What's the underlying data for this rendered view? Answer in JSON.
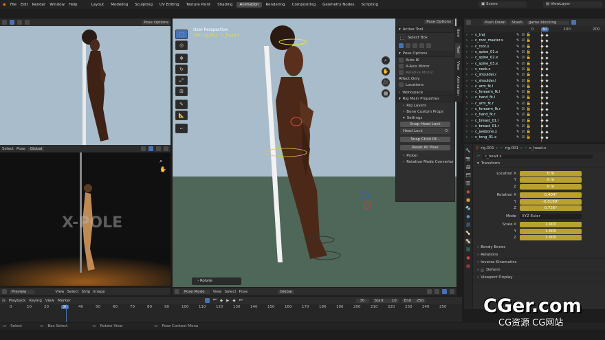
{
  "menu": {
    "items": [
      "File",
      "Edit",
      "Render",
      "Window",
      "Help"
    ],
    "workspaces": [
      "Layout",
      "Modeling",
      "Sculpting",
      "UV Editing",
      "Texture Paint",
      "Shading",
      "Animation",
      "Rendering",
      "Compositing",
      "Geometry Nodes",
      "Scripting"
    ],
    "active_workspace": "Animation",
    "scene": "Scene",
    "view_layer": "ViewLayer"
  },
  "left_top": {
    "header_right": "Pose Options",
    "footer": {
      "select": "Select",
      "pose": "Pose",
      "orientation": "Global"
    }
  },
  "left_bottom": {
    "header": {
      "mode": "Preview",
      "view": "View",
      "select": "Select",
      "strip": "Strip",
      "image": "Image"
    },
    "watermark": "X-POLE"
  },
  "viewport": {
    "title": "User Perspective",
    "subtitle": "(30) rig.001 : c_head.x",
    "header": {
      "mode": "Pose Mode",
      "view": "View",
      "select": "Select",
      "pose": "Pose",
      "orientation": "Global"
    },
    "operator": "Rotate"
  },
  "npanel": {
    "header": "Pose Options",
    "tabs": [
      "Item",
      "Tool",
      "View",
      "Animation"
    ],
    "active_tool": {
      "title": "Active Tool",
      "name": "Select Box"
    },
    "pose_options": {
      "title": "Pose Options",
      "auto_ik": "Auto IK",
      "x_axis_mirror": "X-Axis Mirror",
      "relative_mirror": "Relative Mirror",
      "affect_only": "Affect Only",
      "locations": "Locations"
    },
    "workspace": "Workspace",
    "rig": {
      "title": "Rig Main Properties",
      "rig_layers": "Rig Layers",
      "bone_custom_props": "Bone Custom Props",
      "settings": "Settings",
      "snap_head_lock": "Snap Head Lock",
      "head_lock": "Head Lock",
      "head_lock_value": "0",
      "snap_child_of": "Snap Child Of...",
      "reset_all_pose": "Reset All Pose",
      "picker": "Picker",
      "rotation_mode_convertor": "Rotation Mode Convertor"
    }
  },
  "dopesheet": {
    "header": {
      "push_down": "Push Down",
      "stash": "Stash",
      "action": "gamu blocking"
    },
    "ruler": [
      "0",
      "30",
      "100",
      "200"
    ],
    "current_frame": "30",
    "channels": [
      "c_traj",
      "c_root_master.x",
      "c_root.x",
      "c_spine_01.x",
      "c_spine_02.x",
      "c_spine_03.x",
      "c_neck.x",
      "c_shoulder.r",
      "c_shoulder.l",
      "c_arm_fk.l",
      "c_forearm_fk.l",
      "c_hand_fk.l",
      "c_arm_fk.r",
      "c_forearm_fk.r",
      "c_hand_fk.r",
      "c_breast_01.l",
      "c_breast_01.r",
      "c_jawbone.x",
      "c_tong_01.x"
    ]
  },
  "properties": {
    "breadcrumb": {
      "object": "rig.001",
      "armature": "rig.001",
      "bone": "c_head.x"
    },
    "bone_name": "c_head.x",
    "transform": {
      "title": "Transform",
      "location": {
        "label": "Location X",
        "x": "0 m",
        "y": "0 m",
        "z": "0 m"
      },
      "rotation": {
        "label": "Rotation X",
        "x": "0.404°",
        "y": "-0.0199°",
        "z": "0.726°"
      },
      "mode_label": "Mode",
      "mode": "XYZ Euler",
      "scale": {
        "label": "Scale X",
        "x": "1.000",
        "y": "1.000",
        "z": "1.000"
      }
    },
    "axis_y": "Y",
    "axis_z": "Z",
    "sections": [
      "Bendy Bones",
      "Relations",
      "Inverse Kinematics",
      "Deform",
      "Viewport Display"
    ]
  },
  "timeline": {
    "playback": "Playback",
    "keying": "Keying",
    "view": "View",
    "marker": "Marker",
    "current": "30",
    "start_label": "Start",
    "start": "10",
    "end_label": "End",
    "end": "250",
    "ruler": [
      "0",
      "10",
      "20",
      "30",
      "40",
      "50",
      "60",
      "70",
      "80",
      "90",
      "100",
      "110",
      "120",
      "130",
      "140",
      "150",
      "160",
      "170",
      "180",
      "190",
      "200",
      "210",
      "220",
      "230",
      "240",
      "250"
    ]
  },
  "status": {
    "select": "Select",
    "box_select": "Box Select",
    "rotate_view": "Rotate View",
    "context_menu": "Pose Context Menu"
  },
  "brand": {
    "site": "CGer.com",
    "tagline": "CG资源 CG网站"
  }
}
